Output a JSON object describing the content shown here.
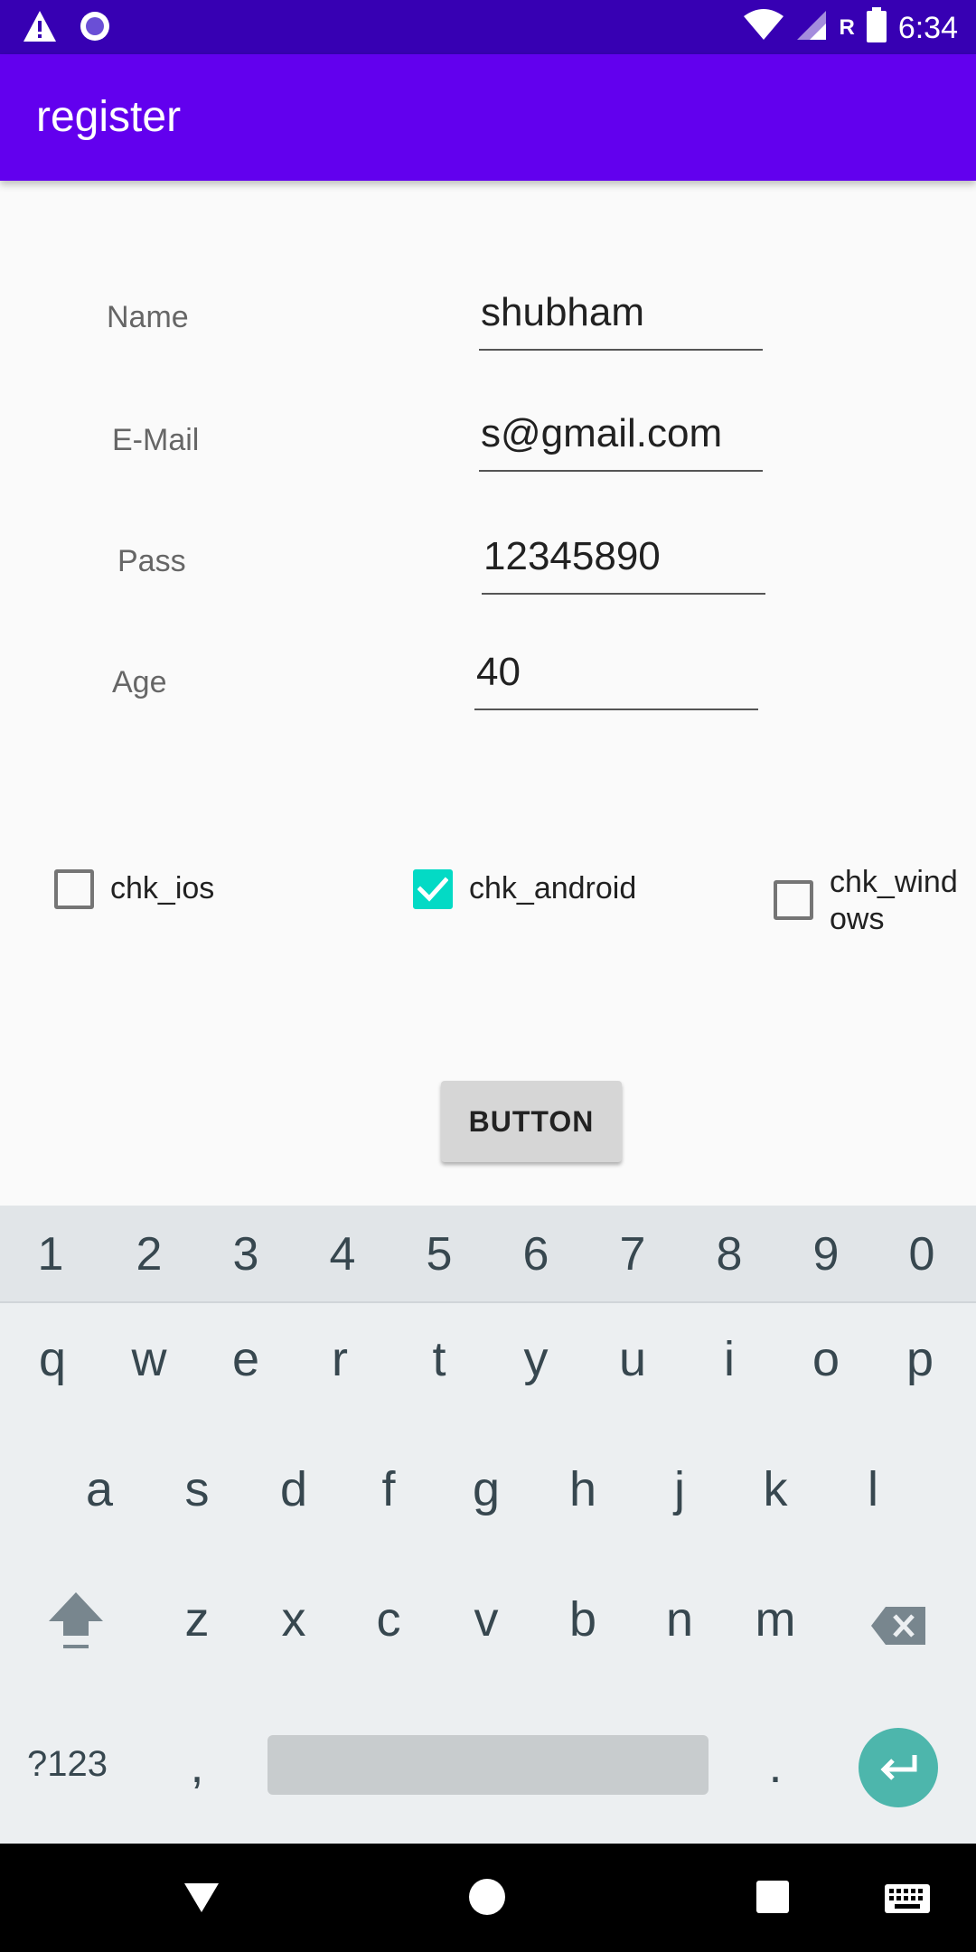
{
  "status_bar": {
    "time": "6:34",
    "network_letter": "R",
    "icons": [
      "warning-icon",
      "record-icon",
      "wifi-icon",
      "signal-icon",
      "battery-icon"
    ]
  },
  "app_bar": {
    "title": "register"
  },
  "form": {
    "name_label": "Name",
    "name_value": "shubham",
    "email_label": "E-Mail",
    "email_value": "s@gmail.com",
    "pass_label": "Pass",
    "pass_value": "12345890",
    "age_label": "Age",
    "age_value": "40"
  },
  "checkboxes": {
    "ios": {
      "label": "chk_ios",
      "checked": false
    },
    "android": {
      "label": "chk_android",
      "checked": true
    },
    "windows": {
      "label_line1": "chk_wind",
      "label_line2": "ows",
      "checked": false
    }
  },
  "button": {
    "label": "BUTTON"
  },
  "keyboard": {
    "numbers": [
      "1",
      "2",
      "3",
      "4",
      "5",
      "6",
      "7",
      "8",
      "9",
      "0"
    ],
    "row1": [
      "q",
      "w",
      "e",
      "r",
      "t",
      "y",
      "u",
      "i",
      "o",
      "p"
    ],
    "row2": [
      "a",
      "s",
      "d",
      "f",
      "g",
      "h",
      "j",
      "k",
      "l"
    ],
    "row3": [
      "z",
      "x",
      "c",
      "v",
      "b",
      "n",
      "m"
    ],
    "symbols_label": "?123",
    "comma": ",",
    "period": ".",
    "accent_color": "#4db6ac"
  },
  "colors": {
    "status_bar": "#3700b3",
    "app_bar": "#6200ee",
    "checkbox_checked": "#03dac5"
  }
}
